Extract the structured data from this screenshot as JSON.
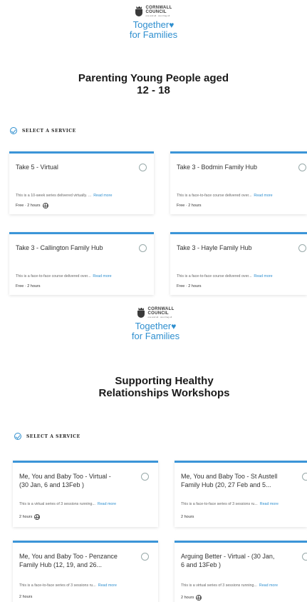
{
  "brand": {
    "council_line1": "CORNWALL",
    "council_line2": "COUNCIL",
    "council_tagline": "one and all · onen hag oll",
    "program_line1": "Together",
    "program_line2": "for Families",
    "heart": "♥",
    "accent_color": "#2f8fcf"
  },
  "sections": [
    {
      "title_line1": "Parenting Young People aged",
      "title_line2": "12 - 18",
      "select_label": "SELECT A SERVICE",
      "cards": [
        {
          "name_line1": "Take 5 - Virtual",
          "name_line2": "",
          "description": "This is a 10-week series delivered virtually. ...",
          "read_more": "Read more",
          "meta": "Free · 2 hours",
          "icon": "globe-icon"
        },
        {
          "name_line1": "Take 3 - Bodmin Family Hub",
          "name_line2": "",
          "description": "This is a face-to-face course delivered over...",
          "read_more": "Read more",
          "meta": "Free · 2 hours",
          "icon": ""
        },
        {
          "name_line1": "Take 3 - Callington Family Hub",
          "name_line2": "",
          "description": "This is a face-to-face course delivered over...",
          "read_more": "Read more",
          "meta": "Free · 2 hours",
          "icon": ""
        },
        {
          "name_line1": "Take 3 - Hayle Family Hub",
          "name_line2": "",
          "description": "This is a face-to-face course delivered over...",
          "read_more": "Read more",
          "meta": "Free · 2 hours",
          "icon": ""
        }
      ]
    },
    {
      "title_line1": "Supporting Healthy",
      "title_line2": "Relationships Workshops",
      "select_label": "SELECT A SERVICE",
      "cards": [
        {
          "name_line1": "Me, You and Baby Too - Virtual -",
          "name_line2": "(30 Jan, 6 and 13Feb )",
          "description": "This is a virtual series of 3 sessions running...",
          "read_more": "Read more",
          "meta": "2 hours",
          "icon": "globe-icon"
        },
        {
          "name_line1": "Me, You and Baby Too - St Austell",
          "name_line2": "Family Hub (20, 27 Feb and 5...",
          "description": "This is a face-to-face series of 3 sessions ru...",
          "read_more": "Read more",
          "meta": "2 hours",
          "icon": ""
        },
        {
          "name_line1": "Me, You and Baby Too - Penzance",
          "name_line2": "Family Hub (12, 19, and 26...",
          "description": "This is a face-to-face series of 3 sessions ru...",
          "read_more": "Read more",
          "meta": "2 hours",
          "icon": ""
        },
        {
          "name_line1": "Arguing Better - Virtual - (30 Jan,",
          "name_line2": "6 and 13Feb )",
          "description": "This is a virtual series of 3 sessions running...",
          "read_more": "Read more",
          "meta": "2 hours",
          "icon": "globe-icon"
        }
      ]
    }
  ]
}
